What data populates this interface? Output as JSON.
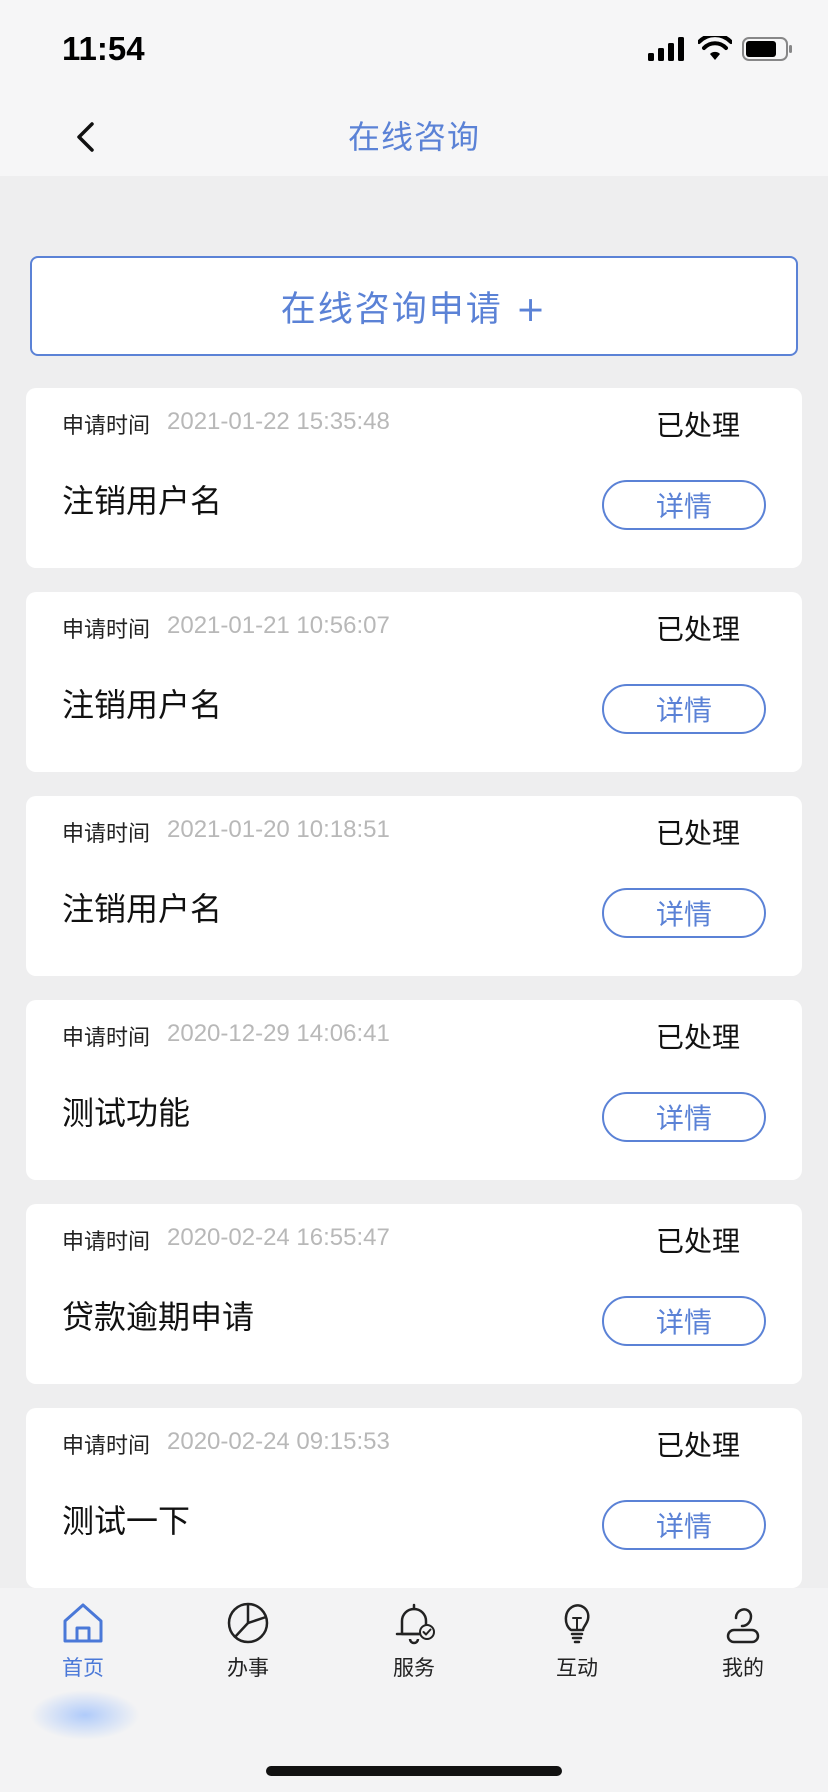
{
  "status_bar": {
    "time": "11:54"
  },
  "nav": {
    "title": "在线咨询"
  },
  "apply_button": {
    "label": "在线咨询申请 +"
  },
  "records": [
    {
      "time_label": "申请时间",
      "time": "2021-01-22 15:35:48",
      "status": "已处理",
      "title": "注销用户名",
      "detail_label": "详情"
    },
    {
      "time_label": "申请时间",
      "time": "2021-01-21 10:56:07",
      "status": "已处理",
      "title": "注销用户名",
      "detail_label": "详情"
    },
    {
      "time_label": "申请时间",
      "time": "2021-01-20 10:18:51",
      "status": "已处理",
      "title": "注销用户名",
      "detail_label": "详情"
    },
    {
      "time_label": "申请时间",
      "time": "2020-12-29 14:06:41",
      "status": "已处理",
      "title": "测试功能",
      "detail_label": "详情"
    },
    {
      "time_label": "申请时间",
      "time": "2020-02-24 16:55:47",
      "status": "已处理",
      "title": "贷款逾期申请",
      "detail_label": "详情"
    },
    {
      "time_label": "申请时间",
      "time": "2020-02-24 09:15:53",
      "status": "已处理",
      "title": "测试一下",
      "detail_label": "详情"
    }
  ],
  "tabs": [
    {
      "label": "首页",
      "icon": "home-icon",
      "active": true
    },
    {
      "label": "办事",
      "icon": "pie-chart-icon",
      "active": false
    },
    {
      "label": "服务",
      "icon": "bell-check-icon",
      "active": false
    },
    {
      "label": "互动",
      "icon": "lightbulb-icon",
      "active": false
    },
    {
      "label": "我的",
      "icon": "user-icon",
      "active": false
    }
  ],
  "colors": {
    "accent": "#5b82d6",
    "active_tab": "#4a78d8",
    "timestamp": "#b8b8b8",
    "background": "#eeeeef"
  }
}
